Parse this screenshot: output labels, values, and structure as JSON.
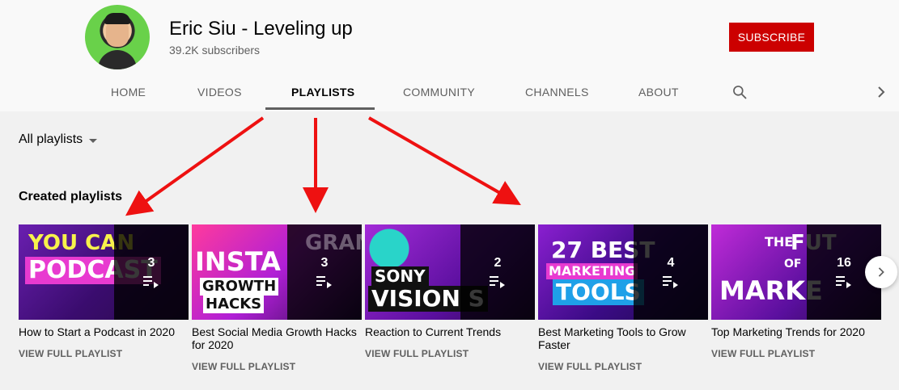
{
  "channel": {
    "name": "Eric Siu - Leveling up",
    "subscribers": "39.2K subscribers",
    "subscribe_label": "SUBSCRIBE"
  },
  "tabs": [
    {
      "label": "HOME",
      "active": false
    },
    {
      "label": "VIDEOS",
      "active": false
    },
    {
      "label": "PLAYLISTS",
      "active": true
    },
    {
      "label": "COMMUNITY",
      "active": false
    },
    {
      "label": "CHANNELS",
      "active": false
    },
    {
      "label": "ABOUT",
      "active": false
    }
  ],
  "filter": {
    "label": "All playlists"
  },
  "section": {
    "title": "Created playlists"
  },
  "playlists": [
    {
      "title": "How to Start a Podcast in 2020",
      "count": "3",
      "link": "VIEW FULL PLAYLIST",
      "thumb_text": [
        "YOU CAN",
        "PODCAST"
      ]
    },
    {
      "title": "Best Social Media Growth Hacks for 2020",
      "count": "3",
      "link": "VIEW FULL PLAYLIST",
      "thumb_text": [
        "INSTA",
        "GROWTH",
        "HACKS",
        "GRAM"
      ]
    },
    {
      "title": "Reaction to Current Trends",
      "count": "2",
      "link": "VIEW FULL PLAYLIST",
      "thumb_text": [
        "SONY",
        "VISION S"
      ]
    },
    {
      "title": "Best Marketing Tools to Grow Faster",
      "count": "4",
      "link": "VIEW FULL PLAYLIST",
      "thumb_text": [
        "27 BEST",
        "MARKETING",
        "TOOLS"
      ]
    },
    {
      "title": "Top Marketing Trends for 2020",
      "count": "16",
      "link": "VIEW FULL PLAYLIST",
      "thumb_text": [
        "THE",
        "FUT",
        "OF",
        "MARKE"
      ]
    }
  ],
  "colors": {
    "subscribe": "#cc0000",
    "annotation_arrow": "#ee1111"
  },
  "icons": {
    "search": "search-icon",
    "nav_next": "chevron-right-icon",
    "playlist": "playlist-play-icon",
    "dropdown": "caret-down-icon"
  }
}
